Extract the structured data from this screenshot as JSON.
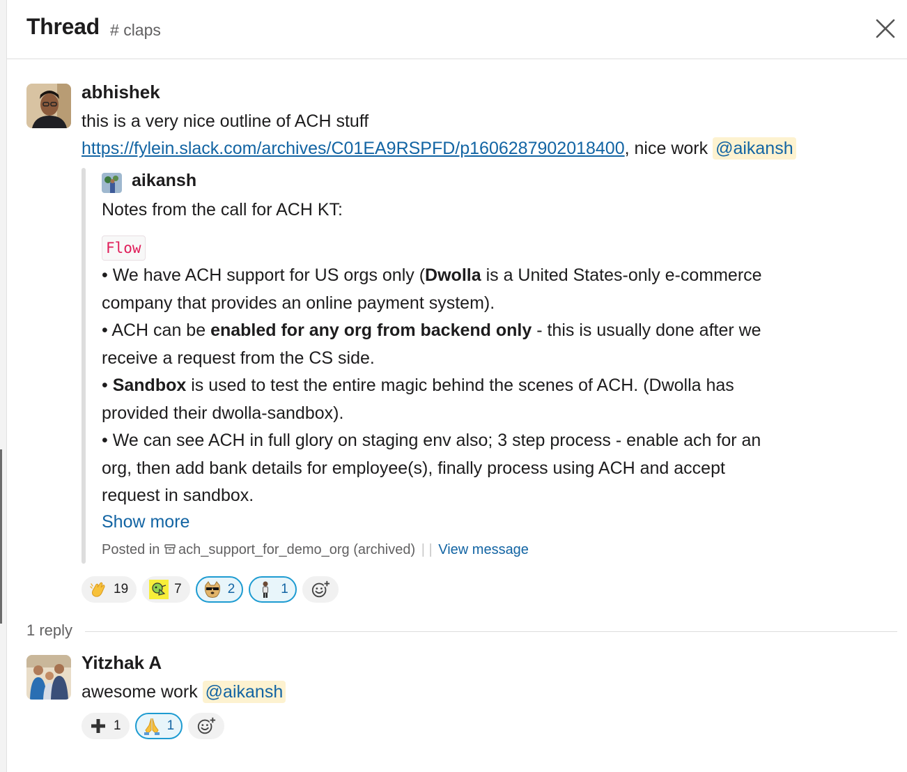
{
  "header": {
    "title": "Thread",
    "channel_hash": "#",
    "channel_name": "claps"
  },
  "parent_message": {
    "author": "abhishek",
    "line1": "this is a very nice outline of ACH stuff",
    "link": "https://fylein.slack.com/archives/C01EA9RSPFD/p1606287902018400",
    "after_link": ", nice work ",
    "mention": "@aikansh",
    "shared": {
      "author": "aikansh",
      "heading": "Notes from the call for ACH KT:",
      "code_label": "Flow",
      "b1_pre": "• We have ACH support for US orgs only (",
      "b1_bold": "Dwolla",
      "b1_rest1": " is a United States-only e-commerce",
      "b1_rest2": "company that provides an online payment system).",
      "b2_pre": "• ACH can be ",
      "b2_bold": "enabled for any org from backend only",
      "b2_rest1": " - this is usually done after we",
      "b2_rest2": "receive a request from the CS side.",
      "b3_pre": "• ",
      "b3_bold": "Sandbox",
      "b3_rest1": " is used to test the entire magic behind the scenes of ACH. (Dwolla has",
      "b3_rest2": "provided their dwolla-sandbox).",
      "b4_l1": "• We can see ACH in full glory on staging env also; 3 step process - enable ach for an",
      "b4_l2": "org, then add bank details for employee(s), finally process using ACH and accept",
      "b4_l3": "request in sandbox.",
      "show_more": "Show more",
      "posted_in": "Posted in",
      "channel": "ach_support_for_demo_org (archived)",
      "divider": "| |",
      "view_message": "View message"
    },
    "reactions": [
      {
        "icon": "clap-icon",
        "count": "19",
        "active": false
      },
      {
        "icon": "party-parrot-icon",
        "count": "7",
        "active": false
      },
      {
        "icon": "doge-sunglasses-icon",
        "count": "2",
        "active": true
      },
      {
        "icon": "person-icon",
        "count": "1",
        "active": true
      }
    ]
  },
  "replies_label": "1 reply",
  "reply": {
    "author": "Yitzhak A",
    "text": "awesome work ",
    "mention": "@aikansh",
    "reactions": [
      {
        "icon": "plus-icon",
        "count": "1",
        "active": false
      },
      {
        "icon": "folded-hands-icon",
        "count": "1",
        "active": true
      }
    ]
  },
  "colors": {
    "link": "#1264a3",
    "mention_bg": "#fdf2d0",
    "active_reaction_border": "#1d9bd1",
    "code_text": "#e01e5a"
  }
}
